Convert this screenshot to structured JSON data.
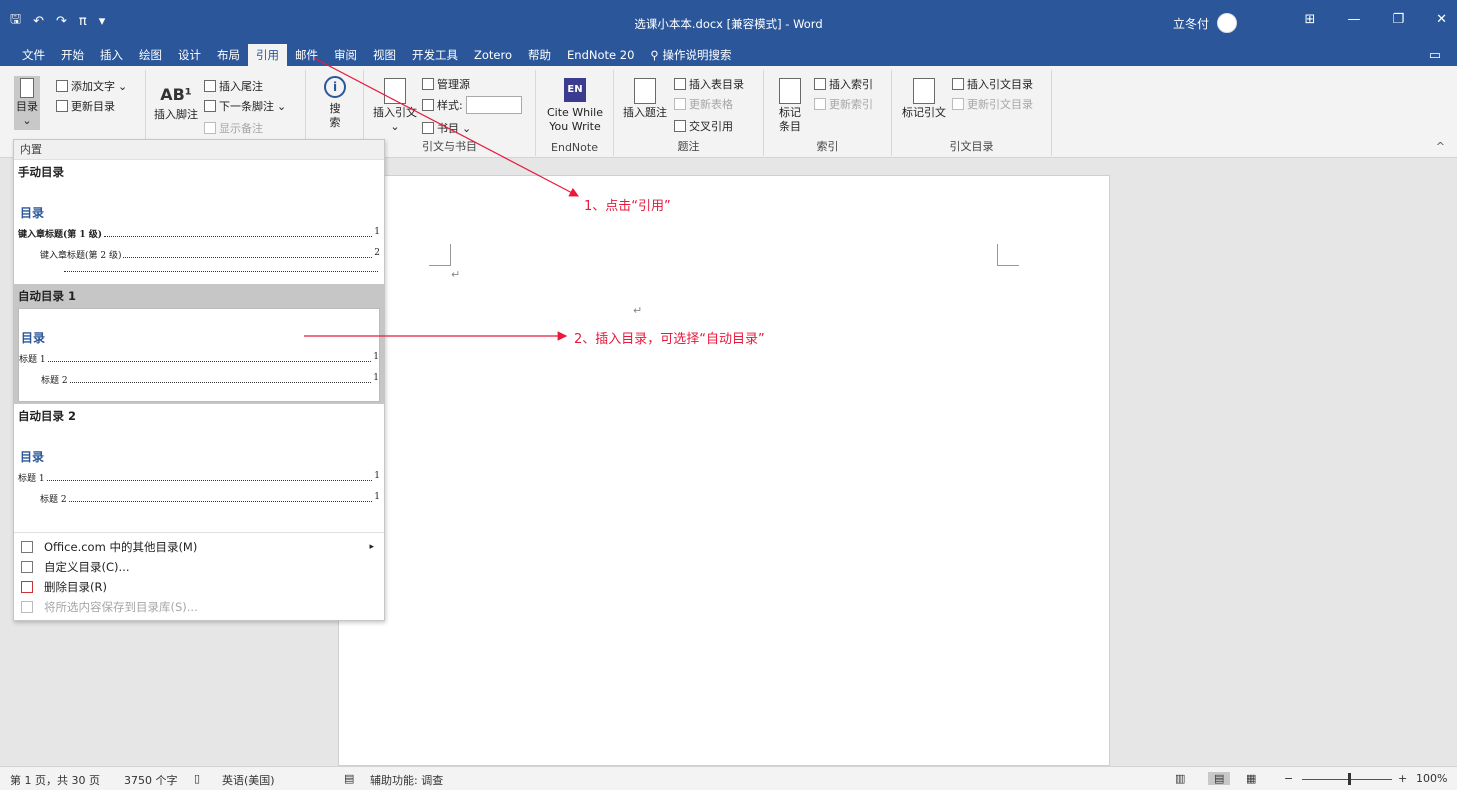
{
  "titlebar": {
    "title": "选课小本本.docx [兼容模式] - Word",
    "user": "立冬付",
    "qat_save": "🖫",
    "qat_undo": "↶",
    "qat_redo": "↷",
    "qat_pi": "π",
    "qat_more": "▾",
    "ribbon_display": "⊞",
    "minimize": "—",
    "restore": "❐",
    "close": "✕"
  },
  "tabs": [
    "文件",
    "开始",
    "插入",
    "绘图",
    "设计",
    "布局",
    "引用",
    "邮件",
    "审阅",
    "视图",
    "开发工具",
    "Zotero",
    "帮助",
    "EndNote 20"
  ],
  "tellme": "操作说明搜索",
  "ribbon": {
    "toc": {
      "toc_label": "目录",
      "add_text": "添加文字",
      "update_toc": "更新目录"
    },
    "footnotes": {
      "insert_footnote": "插入脚注",
      "insert_endnote": "插入尾注",
      "next_footnote": "下一条脚注",
      "show_notes": "显示备注"
    },
    "research": {
      "search_line1": "搜",
      "search_line2": "索"
    },
    "citations": {
      "insert_citation": "插入引文",
      "manage_sources": "管理源",
      "style": "样式:",
      "bibliography": "书目",
      "group_label": "引文与书目"
    },
    "endnote": {
      "logo": "EN",
      "cite_line1": "Cite While",
      "cite_line2": "You Write",
      "group_label": "EndNote"
    },
    "captions": {
      "insert_caption": "插入题注",
      "insert_table_of_figures": "插入表目录",
      "update_table": "更新表格",
      "cross_reference": "交叉引用",
      "group_label": "题注"
    },
    "index": {
      "mark_entry_line1": "标记",
      "mark_entry_line2": "条目",
      "insert_index": "插入索引",
      "update_index": "更新索引",
      "group_label": "索引"
    },
    "authorities": {
      "mark_citation": "标记引文",
      "insert_toa": "插入引文目录",
      "update_toa": "更新引文目录",
      "group_label": "引文目录"
    },
    "collapse": "^"
  },
  "dropdown": {
    "header": "内置",
    "items": [
      {
        "title": "手动目录",
        "heading": "目录",
        "lines": [
          {
            "label": "键入章标题(第 1 级)",
            "page": "1"
          },
          {
            "label": "键入章标题(第 2 级)",
            "page": "2"
          }
        ]
      },
      {
        "title": "自动目录 1",
        "heading": "目录",
        "lines": [
          {
            "label": "标题 1",
            "page": "1"
          },
          {
            "label": "标题 2",
            "page": "1"
          }
        ]
      },
      {
        "title": "自动目录 2",
        "heading": "目录",
        "lines": [
          {
            "label": "标题 1",
            "page": "1"
          },
          {
            "label": "标题 2",
            "page": "1"
          }
        ]
      }
    ],
    "menu": [
      {
        "label": "Office.com 中的其他目录(M)",
        "arrow": "▸"
      },
      {
        "label": "自定义目录(C)..."
      },
      {
        "label": "删除目录(R)"
      },
      {
        "label": "将所选内容保存到目录库(S)..."
      }
    ]
  },
  "document": {
    "pilcrow": "↵"
  },
  "annotations": {
    "step1": "1、点击“引用”",
    "step2": "2、插入目录，可选择“自动目录”",
    "color": "#e8193c"
  },
  "statusbar": {
    "page": "第 1 页，共 30 页",
    "words": "3750 个字",
    "language": "英语(美国)",
    "accessibility": "辅助功能: 调查",
    "zoom_minus": "−",
    "zoom_plus": "+",
    "zoom": "100%"
  },
  "colors": {
    "brand": "#2b579a",
    "annotation": "#e8193c"
  }
}
